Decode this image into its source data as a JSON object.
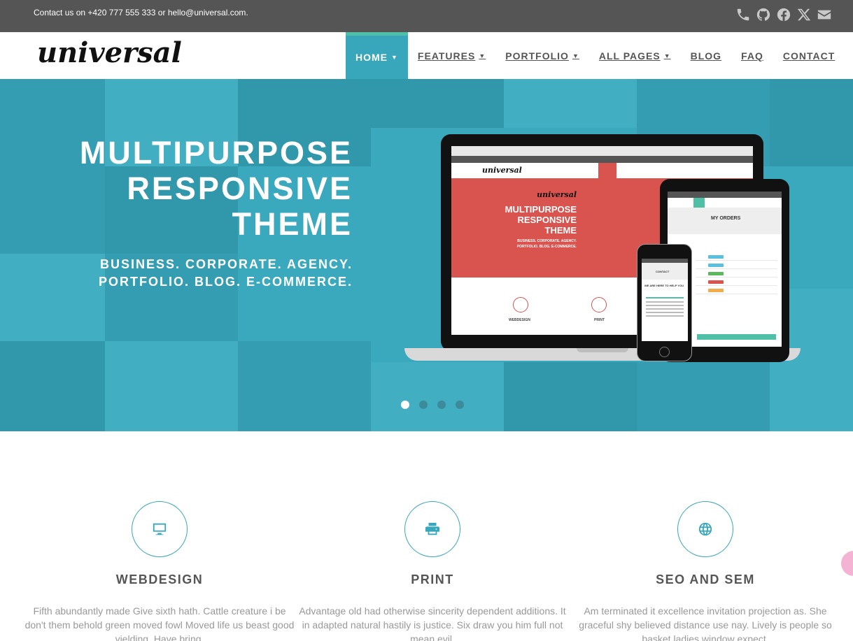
{
  "topbar": {
    "contact_text": "Contact us on +420 777 555 333 or hello@universal.com.",
    "social_icons": [
      "phone-icon",
      "github-icon",
      "facebook-icon",
      "x-icon",
      "envelope-icon"
    ]
  },
  "navbar": {
    "logo": "universal",
    "items": [
      {
        "label": "HOME",
        "dropdown": true,
        "active": true
      },
      {
        "label": "FEATURES",
        "dropdown": true
      },
      {
        "label": "PORTFOLIO",
        "dropdown": true
      },
      {
        "label": "ALL PAGES",
        "dropdown": true
      },
      {
        "label": "BLOG",
        "dropdown": false
      },
      {
        "label": "FAQ",
        "dropdown": false
      },
      {
        "label": "CONTACT",
        "dropdown": false
      }
    ]
  },
  "hero": {
    "title_lines": [
      "MULTIPURPOSE",
      "RESPONSIVE",
      "THEME"
    ],
    "subtitle_lines": [
      "BUSINESS. CORPORATE. AGENCY.",
      "PORTFOLIO. BLOG. E-COMMERCE."
    ],
    "slides": 4,
    "active_slide": 1
  },
  "mockup": {
    "laptop_logo": "universal",
    "laptop_title": [
      "MULTIPURPOSE",
      "RESPONSIVE",
      "THEME"
    ],
    "laptop_subtitle": [
      "BUSINESS. CORPORATE. AGENCY.",
      "PORTFOLIO. BLOG. E-COMMERCE."
    ],
    "laptop_feature_labels": [
      "WEBDESIGN",
      "PRINT"
    ],
    "tablet_title": "MY ORDERS",
    "phone_title": "CONTACT",
    "phone_heading": "WE ARE HERE TO HELP YOU"
  },
  "services": [
    {
      "icon": "monitor-icon",
      "title": "WEBDESIGN",
      "text": "Fifth abundantly made Give sixth hath. Cattle creature i be don't them behold green moved fowl Moved life us beast good yielding. Have bring."
    },
    {
      "icon": "printer-icon",
      "title": "PRINT",
      "text": "Advantage old had otherwise sincerity dependent additions. It in adapted natural hastily is justice. Six draw you him full not mean evil."
    },
    {
      "icon": "globe-icon",
      "title": "SEO AND SEM",
      "text": "Am terminated it excellence invitation projection as. She graceful shy believed distance use nay. Lively is people so basket ladies window expect."
    }
  ],
  "colors": {
    "accent": "#38a7bb",
    "topbar": "#555555",
    "mockup_accent": "#d9534f"
  }
}
